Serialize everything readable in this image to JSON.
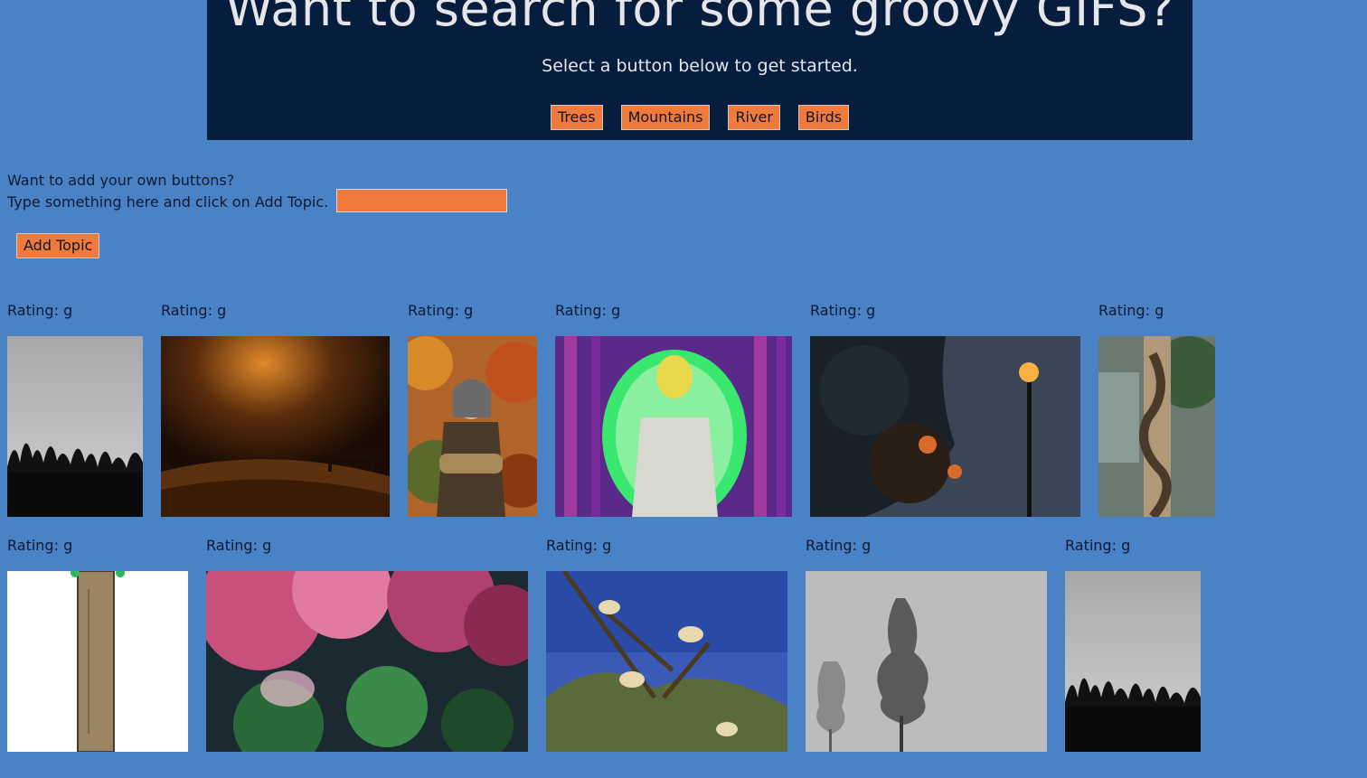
{
  "header": {
    "title": "Want to search for some groovy GIFS?",
    "subtitle": "Select a button below to get started."
  },
  "topics": [
    "Trees",
    "Mountains",
    "River",
    "Birds"
  ],
  "add_topic": {
    "prompt_line1": "Want to add your own buttons?",
    "prompt_line2": "Type something here and click on Add Topic.",
    "input_value": "",
    "button_label": "Add Topic"
  },
  "gifs": [
    {
      "rating": "Rating: g",
      "icon": "tree-silhouette-image"
    },
    {
      "rating": "Rating: g",
      "icon": "autumn-park-bench-image"
    },
    {
      "rating": "Rating: g",
      "icon": "woman-holding-log-image"
    },
    {
      "rating": "Rating: g",
      "icon": "glowing-cartoon-man-image"
    },
    {
      "rating": "Rating: g",
      "icon": "street-lamp-tree-image"
    },
    {
      "rating": "Rating: g",
      "icon": "snake-on-tree-image"
    },
    {
      "rating": "Rating: g",
      "icon": "cartoon-tree-trunk-image"
    },
    {
      "rating": "Rating: g",
      "icon": "cherry-blossom-forest-image"
    },
    {
      "rating": "Rating: g",
      "icon": "goats-in-tree-image"
    },
    {
      "rating": "Rating: g",
      "icon": "foggy-pines-image"
    },
    {
      "rating": "Rating: g",
      "icon": "tree-silhouette-image"
    }
  ],
  "colors": {
    "background": "#4a82c6",
    "hero": "#061d3d",
    "accent": "#ef7a3b"
  }
}
